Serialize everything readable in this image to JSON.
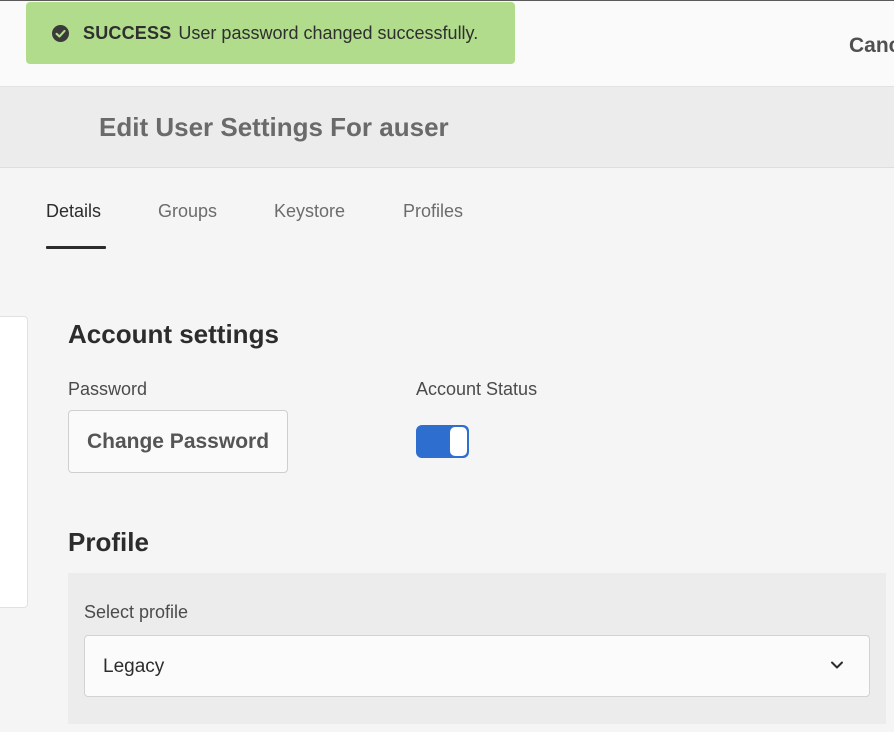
{
  "top_bar": {
    "cancel_label": "Canc"
  },
  "toast": {
    "status": "SUCCESS",
    "message": "User password changed successfully.",
    "icon": "check-circle-icon",
    "background_color": "#b0dc8c"
  },
  "header": {
    "title": "Edit User Settings For auser"
  },
  "tabs": [
    {
      "label": "Details",
      "active": true
    },
    {
      "label": "Groups",
      "active": false
    },
    {
      "label": "Keystore",
      "active": false
    },
    {
      "label": "Profiles",
      "active": false
    }
  ],
  "account_settings": {
    "heading": "Account settings",
    "password_label": "Password",
    "change_password_label": "Change Password",
    "account_status_label": "Account Status",
    "account_status_on": true,
    "toggle_color": "#2e6ecf"
  },
  "profile": {
    "heading": "Profile",
    "select_label": "Select profile",
    "selected_value": "Legacy",
    "icon": "chevron-down-icon"
  }
}
